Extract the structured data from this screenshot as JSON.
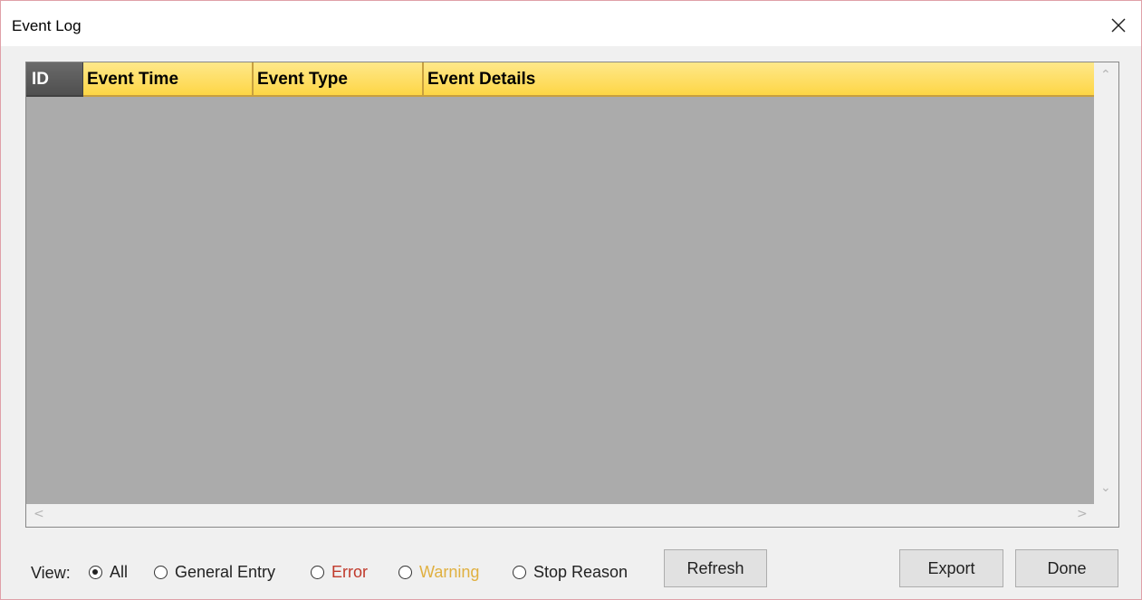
{
  "window": {
    "title": "Event Log",
    "close_icon": "close-icon"
  },
  "grid": {
    "columns": [
      "ID",
      "Event Time",
      "Event Type",
      "Event Details"
    ],
    "rows": [],
    "header_color": "#fdd646",
    "background_color": "#ababab"
  },
  "filter": {
    "label": "View:",
    "options": [
      {
        "label": "All",
        "selected": true,
        "color": "#222222"
      },
      {
        "label": "General Entry",
        "selected": false,
        "color": "#222222"
      },
      {
        "label": "Error",
        "selected": false,
        "color": "#c0392b"
      },
      {
        "label": "Warning",
        "selected": false,
        "color": "#e0b040"
      },
      {
        "label": "Stop Reason",
        "selected": false,
        "color": "#222222"
      }
    ]
  },
  "buttons": {
    "refresh": "Refresh",
    "export": "Export",
    "done": "Done"
  }
}
